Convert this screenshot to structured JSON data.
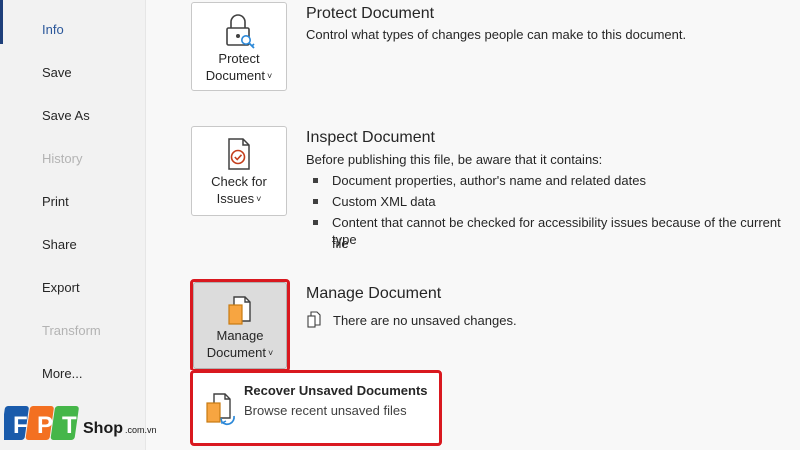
{
  "sidebar": {
    "items": [
      {
        "label": "Info",
        "state": "active"
      },
      {
        "label": "Save",
        "state": "normal"
      },
      {
        "label": "Save As",
        "state": "normal"
      },
      {
        "label": "History",
        "state": "disabled"
      },
      {
        "label": "Print",
        "state": "normal"
      },
      {
        "label": "Share",
        "state": "normal"
      },
      {
        "label": "Export",
        "state": "normal"
      },
      {
        "label": "Transform",
        "state": "disabled"
      },
      {
        "label": "More...",
        "state": "normal"
      }
    ]
  },
  "protect": {
    "button_line1": "Protect",
    "button_line2": "Document",
    "chevron": "˅",
    "title": "Protect Document",
    "description": "Control what types of changes people can make to this document.",
    "icon": "lock-key-icon"
  },
  "inspect": {
    "button_line1": "Check for",
    "button_line2": "Issues",
    "chevron": "˅",
    "title": "Inspect Document",
    "intro": "Before publishing this file, be aware that it contains:",
    "bullets": [
      "Document properties, author's name and related dates",
      "Custom XML data",
      "Content that cannot be checked for accessibility issues because of the current file",
      "type"
    ],
    "icon": "document-check-icon"
  },
  "manage": {
    "button_line1": "Manage",
    "button_line2": "Document",
    "chevron": "˅",
    "title": "Manage Document",
    "status": "There are no unsaved changes.",
    "icon": "documents-icon"
  },
  "recover_menu": {
    "title": "Recover Unsaved Documents",
    "description": "Browse recent unsaved files",
    "icon": "recover-documents-icon"
  },
  "watermark": {
    "brand": "FPT",
    "shop": "Shop",
    "domain": ".com.vn"
  },
  "colors": {
    "accent": "#2b579a",
    "highlight": "#d9181f",
    "fpt_blue": "#1a5bab",
    "fpt_orange": "#f37021",
    "fpt_green": "#45b649"
  }
}
